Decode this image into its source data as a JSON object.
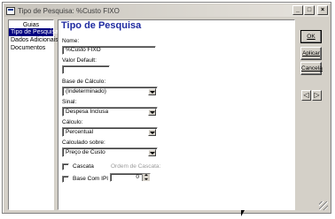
{
  "window": {
    "title": "Tipo de Pesquisa: %Custo FIXO",
    "minimize_glyph": "_",
    "maximize_glyph": "□",
    "close_glyph": "×"
  },
  "guias": {
    "title": "Guias",
    "items": [
      {
        "label": "Tipo de Pesquisa",
        "selected": true
      },
      {
        "label": "Dados Adicionais",
        "selected": false
      },
      {
        "label": "Documentos",
        "selected": false
      }
    ]
  },
  "form": {
    "title": "Tipo de Pesquisa",
    "nome": {
      "label": "Nome:",
      "value": "%Custo FIXO"
    },
    "valor_default": {
      "label": "Valor Default:",
      "value": ""
    },
    "base_calculo": {
      "label": "Base de Cálculo:",
      "value": "(Indeterminado)"
    },
    "sinal": {
      "label": "Sinal:",
      "value": "Despesa Inclusa"
    },
    "calculo": {
      "label": "Cálculo:",
      "value": "Percentual"
    },
    "calculado_sobre": {
      "label": "Calculado sobre:",
      "value": "Preço de Custo"
    },
    "cascata": {
      "label": "Cascata",
      "checked": false
    },
    "ordem_cascata": {
      "label": "Ordem de Cascata:"
    },
    "base_com_ipi": {
      "label": "Base Com IPI",
      "checked": false
    },
    "spin_value": "0"
  },
  "buttons": {
    "ok": "OK",
    "aplicar": "Aplicar",
    "cancela": "Cancela",
    "nav_prev": "◁",
    "nav_next": "▷"
  }
}
